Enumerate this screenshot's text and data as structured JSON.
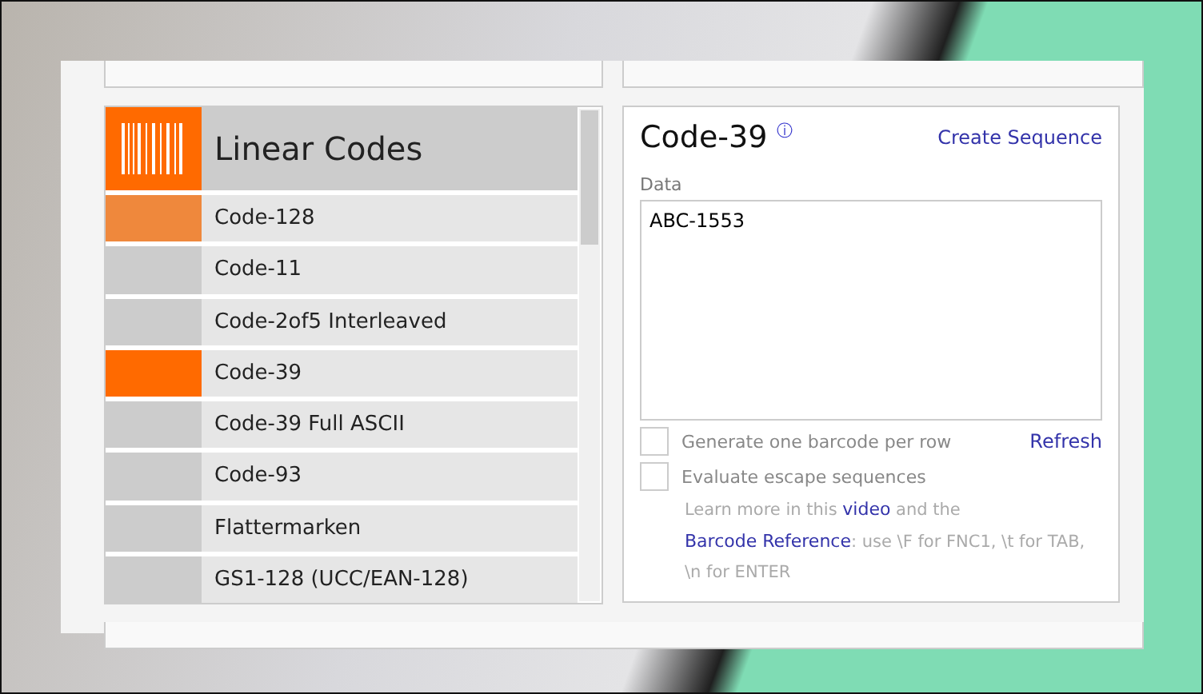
{
  "category": {
    "title": "Linear Codes"
  },
  "items": [
    {
      "label": "Code-128",
      "selected": false,
      "hovered": true
    },
    {
      "label": "Code-11",
      "selected": false,
      "hovered": false
    },
    {
      "label": "Code-2of5 Interleaved",
      "selected": false,
      "hovered": false
    },
    {
      "label": "Code-39",
      "selected": true,
      "hovered": false
    },
    {
      "label": "Code-39 Full ASCII",
      "selected": false,
      "hovered": false
    },
    {
      "label": "Code-93",
      "selected": false,
      "hovered": false
    },
    {
      "label": "Flattermarken",
      "selected": false,
      "hovered": false
    },
    {
      "label": "GS1-128 (UCC/EAN-128)",
      "selected": false,
      "hovered": false
    }
  ],
  "detail": {
    "title": "Code-39",
    "info": "ⓘ",
    "link": "Create Sequence",
    "data_label": "Data",
    "data_value": "ABC-1553",
    "options": [
      {
        "label": "Generate one barcode per row",
        "checked": false
      },
      {
        "label": "Evaluate escape sequences",
        "checked": false
      }
    ],
    "refresh": "Refresh",
    "help": [
      "Learn more in this ",
      {
        "link": "video"
      },
      " and the ",
      {
        "link": "Barcode Reference"
      },
      ": use \\F for FNC1, \\t for TAB, \\n for ENTER"
    ]
  }
}
